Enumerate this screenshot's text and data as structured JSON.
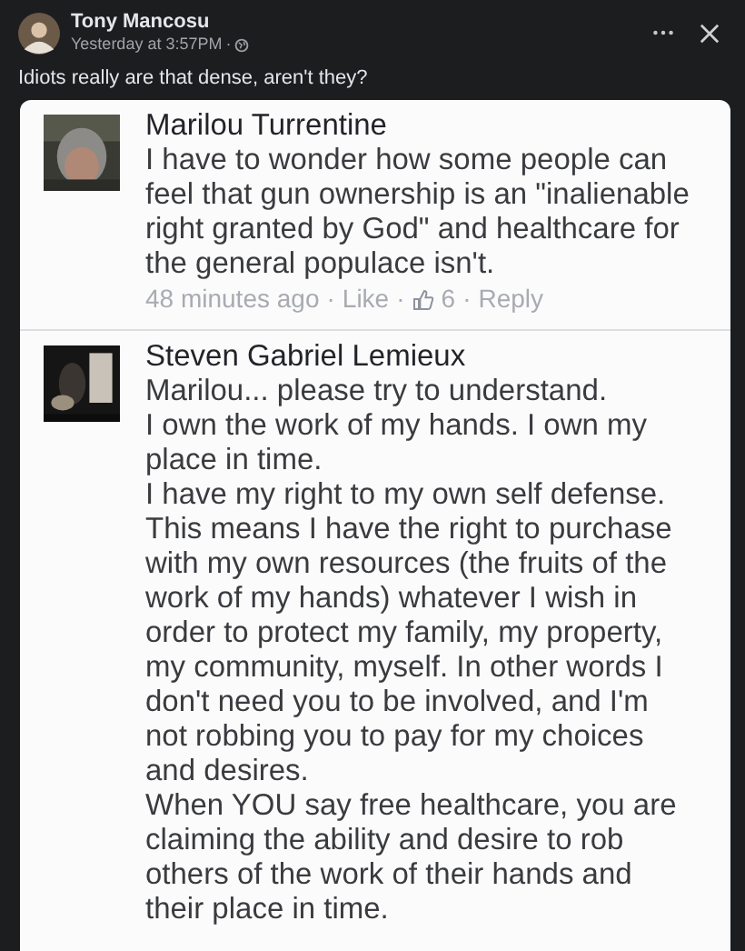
{
  "post": {
    "author": "Tony Mancosu",
    "time": "Yesterday at 3:57PM",
    "separator": "·",
    "text": "Idiots really are that dense, aren't they?"
  },
  "comments": [
    {
      "name": "Marilou Turrentine",
      "paragraphs": [
        "I have to wonder how some people can feel that gun ownership is an \"inalienable right granted by God\" and healthcare for the general populace isn't."
      ],
      "meta": [
        {
          "kind": "time",
          "text": "48 minutes ago"
        },
        {
          "kind": "separator",
          "text": "·"
        },
        {
          "kind": "link",
          "text": "Like"
        },
        {
          "kind": "separator",
          "text": "·"
        },
        {
          "kind": "likes",
          "text": "6"
        },
        {
          "kind": "separator",
          "text": "·"
        },
        {
          "kind": "link",
          "text": "Reply"
        }
      ]
    },
    {
      "name": "Steven Gabriel Lemieux",
      "paragraphs": [
        "Marilou... please try to understand.",
        "I own the work of my hands. I own my place in time.",
        "I have my right to my own self defense.",
        "This means I have the right to purchase with my own resources (the fruits of the work of my hands) whatever I wish in order to protect my family, my property, my community, myself. In other words I don't need you to be involved, and I'm not robbing you to pay for my choices and desires.",
        "When YOU say free healthcare, you are claiming the ability and desire to rob others of the work of their hands and their place in time."
      ]
    }
  ]
}
